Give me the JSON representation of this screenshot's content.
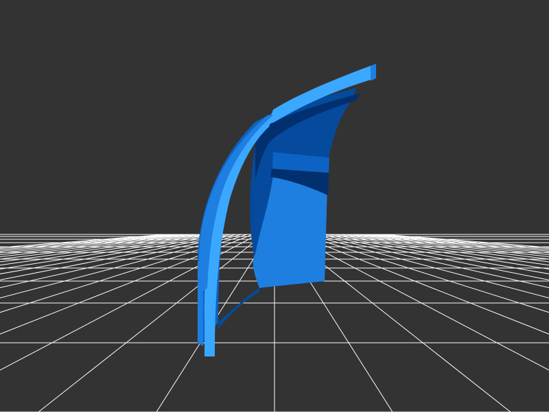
{
  "viewer": {
    "background_color": "#333333",
    "grid_color": "#ffffff",
    "model": {
      "name": "curved-shell-part",
      "colors": {
        "highlight": "#3aa8ff",
        "base": "#1e7fe0",
        "mid": "#0d63c4",
        "dark": "#054a9c",
        "shadow": "#02306e"
      }
    }
  }
}
